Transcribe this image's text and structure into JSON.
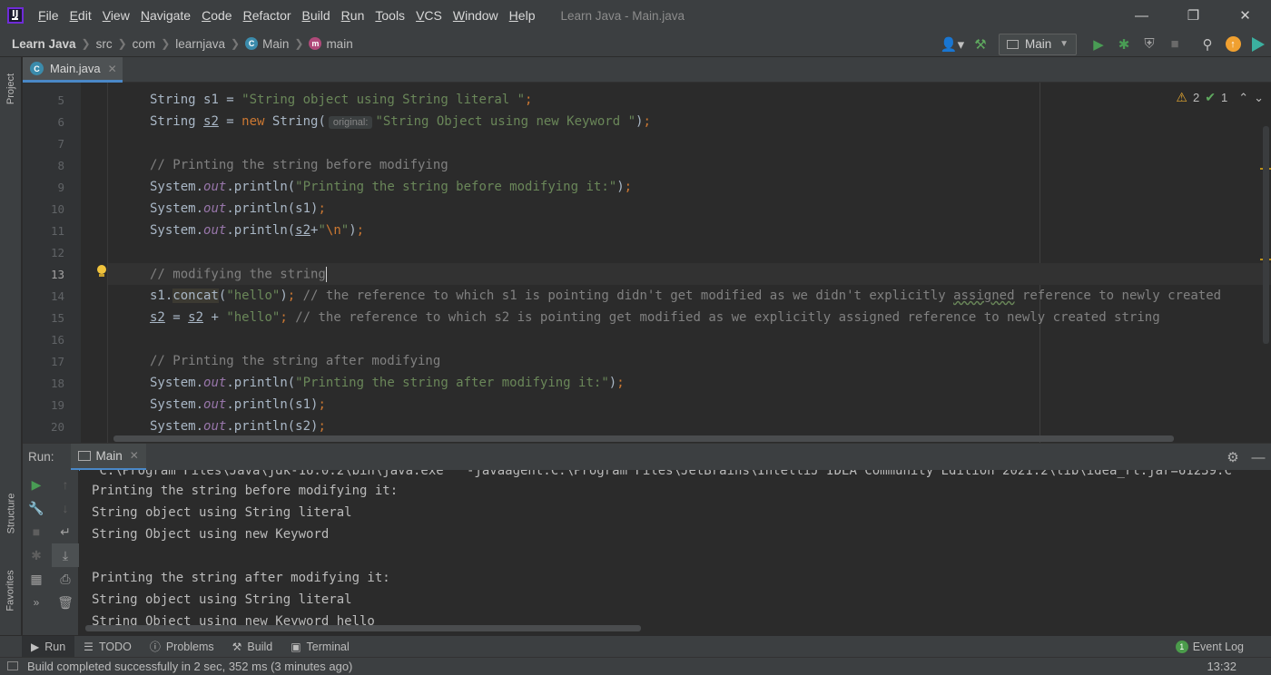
{
  "menubar": {
    "items": [
      "File",
      "Edit",
      "View",
      "Navigate",
      "Code",
      "Refactor",
      "Build",
      "Run",
      "Tools",
      "VCS",
      "Window",
      "Help"
    ],
    "title": "Learn Java - Main.java"
  },
  "navbar": {
    "crumbs": [
      "Learn Java",
      "src",
      "com",
      "learnjava",
      "Main",
      "main"
    ],
    "run_config": "Main"
  },
  "left_strip": {
    "project": "Project",
    "structure": "Structure",
    "favorites": "Favorites"
  },
  "editor": {
    "tab_label": "Main.java",
    "inspections": {
      "warnings": "2",
      "weak_warnings": "1"
    },
    "lines": [
      {
        "num": "5",
        "tokens": [
          [
            "pl",
            "String "
          ],
          [
            "pl",
            "s1 = "
          ],
          [
            "str",
            "\"String object using String literal \""
          ],
          [
            "kw",
            ";"
          ]
        ]
      },
      {
        "num": "6",
        "tokens": [
          [
            "pl",
            "String "
          ],
          [
            "ul",
            "s2"
          ],
          [
            "pl",
            " = "
          ],
          [
            "kw",
            "new "
          ],
          [
            "pl",
            "String("
          ],
          [
            "hint",
            "original:"
          ],
          [
            "str",
            "\"String Object using new Keyword \""
          ],
          [
            "pl",
            ")"
          ],
          [
            "kw",
            ";"
          ]
        ]
      },
      {
        "num": "7",
        "tokens": []
      },
      {
        "num": "8",
        "tokens": [
          [
            "cm",
            "// Printing the string before modifying"
          ]
        ]
      },
      {
        "num": "9",
        "tokens": [
          [
            "pl",
            "System."
          ],
          [
            "fld",
            "out"
          ],
          [
            "pl",
            ".println("
          ],
          [
            "str",
            "\"Printing the string before modifying it:\""
          ],
          [
            "pl",
            ")"
          ],
          [
            "kw",
            ";"
          ]
        ]
      },
      {
        "num": "10",
        "tokens": [
          [
            "pl",
            "System."
          ],
          [
            "fld",
            "out"
          ],
          [
            "pl",
            ".println(s1)"
          ],
          [
            "kw",
            ";"
          ]
        ]
      },
      {
        "num": "11",
        "tokens": [
          [
            "pl",
            "System."
          ],
          [
            "fld",
            "out"
          ],
          [
            "pl",
            ".println("
          ],
          [
            "ul",
            "s2"
          ],
          [
            "pl",
            "+"
          ],
          [
            "str",
            "\""
          ],
          [
            "kw",
            "\\n"
          ],
          [
            "str",
            "\""
          ],
          [
            "pl",
            ")"
          ],
          [
            "kw",
            ";"
          ]
        ]
      },
      {
        "num": "12",
        "tokens": []
      },
      {
        "num": "13",
        "tokens": [
          [
            "cm",
            "// modifying the string"
          ],
          [
            "caret",
            ""
          ]
        ]
      },
      {
        "num": "14",
        "tokens": [
          [
            "pl",
            "s1."
          ],
          [
            "hl",
            "concat"
          ],
          [
            "pl",
            "("
          ],
          [
            "str",
            "\"hello\""
          ],
          [
            "pl",
            ")"
          ],
          [
            "kw",
            "; "
          ],
          [
            "cm",
            "// the reference to which s1 is pointing didn't get modified as we didn't explicitly "
          ],
          [
            "sq",
            "assigned"
          ],
          [
            "cm",
            " reference to newly created"
          ]
        ]
      },
      {
        "num": "15",
        "tokens": [
          [
            "ul",
            "s2"
          ],
          [
            "pl",
            " = "
          ],
          [
            "ul",
            "s2"
          ],
          [
            "pl",
            " + "
          ],
          [
            "str",
            "\"hello\""
          ],
          [
            "kw",
            "; "
          ],
          [
            "cm",
            "// the reference to which s2 is pointing get modified as we explicitly assigned reference to newly created string"
          ]
        ]
      },
      {
        "num": "16",
        "tokens": []
      },
      {
        "num": "17",
        "tokens": [
          [
            "cm",
            "// Printing the string after modifying"
          ]
        ]
      },
      {
        "num": "18",
        "tokens": [
          [
            "pl",
            "System."
          ],
          [
            "fld",
            "out"
          ],
          [
            "pl",
            ".println("
          ],
          [
            "str",
            "\"Printing the string after modifying it:\""
          ],
          [
            "pl",
            ")"
          ],
          [
            "kw",
            ";"
          ]
        ]
      },
      {
        "num": "19",
        "tokens": [
          [
            "pl",
            "System."
          ],
          [
            "fld",
            "out"
          ],
          [
            "pl",
            ".println(s1)"
          ],
          [
            "kw",
            ";"
          ]
        ]
      },
      {
        "num": "20",
        "tokens": [
          [
            "pl",
            "System."
          ],
          [
            "fld",
            "out"
          ],
          [
            "pl",
            ".println(s2)"
          ],
          [
            "kw",
            ";"
          ]
        ]
      }
    ]
  },
  "run_panel": {
    "title": "Run:",
    "tab_label": "Main",
    "output": [
      "\"C:\\Program Files\\Java\\jdk-16.0.2\\bin\\java.exe\" \"-javaagent:C:\\Program Files\\JetBrains\\IntelliJ IDEA Community Edition 2021.2\\lib\\idea_rt.jar=61239:C",
      "Printing the string before modifying it:",
      "String object using String literal",
      "String Object using new Keyword",
      "",
      "Printing the string after modifying it:",
      "String object using String literal",
      "String Object using new Keyword hello"
    ]
  },
  "bottom_tools": {
    "run": "Run",
    "todo": "TODO",
    "problems": "Problems",
    "build": "Build",
    "terminal": "Terminal",
    "event_log": "Event Log"
  },
  "status": {
    "message": "Build completed successfully in 2 sec, 352 ms (3 minutes ago)",
    "position": "13:32"
  },
  "colors": {
    "accent": "#4a88c7",
    "run_green": "#499c54",
    "warning": "#e2a631"
  }
}
